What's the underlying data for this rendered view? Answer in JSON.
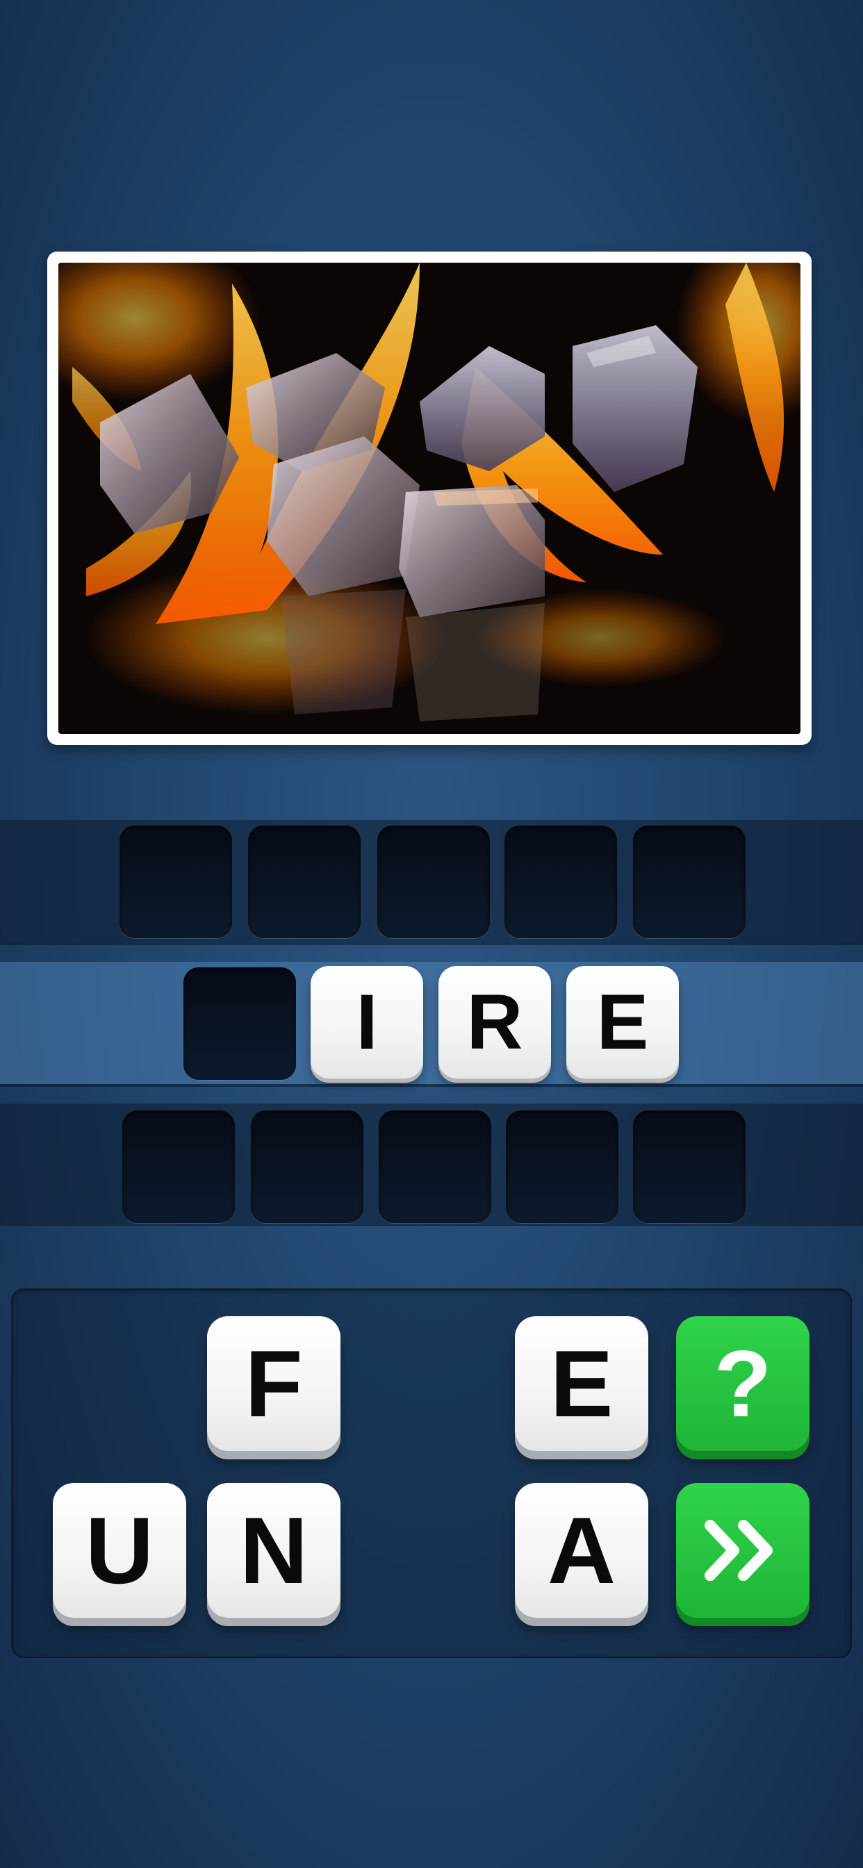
{
  "answer": {
    "row_top_slots": 5,
    "row_bottom_slots": 5,
    "row_middle": [
      "",
      "I",
      "R",
      "E"
    ]
  },
  "keyboard": {
    "letters": [
      "F",
      "E",
      "U",
      "N",
      "A"
    ],
    "hint_button_label": "?",
    "skip_icon": "double-chevron-right-icon"
  },
  "photo": {
    "subject": "ice-cubes-in-flames",
    "flame_color": "#ff8a00",
    "background_color": "#0b0604"
  },
  "colors": {
    "accent_green": "#22c13d",
    "background_blue": "#234a72"
  }
}
